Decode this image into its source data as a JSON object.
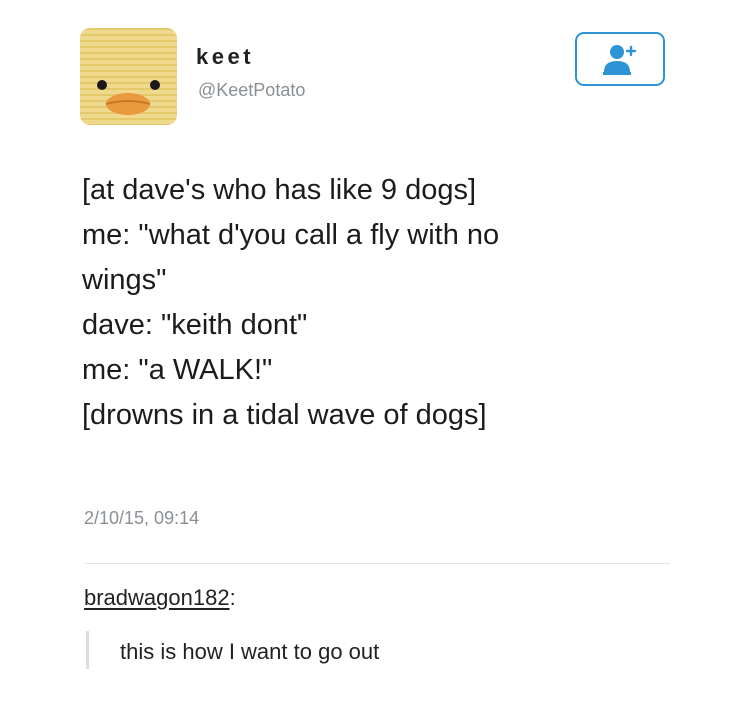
{
  "author": {
    "display_name": "keet",
    "handle": "@KeetPotato",
    "avatar_icon": "duck-face-avatar"
  },
  "follow_button": {
    "icon": "add-user-icon",
    "accent": "#2f94d6"
  },
  "tweet": {
    "lines": [
      "[at dave's who has like 9 dogs]",
      "me: \"what d'you call a fly with no",
      "wings\"",
      "dave: \"keith dont\"",
      "me: \"a WALK!\"",
      "[drowns in a tidal wave of dogs]"
    ],
    "timestamp": "2/10/15, 09:14"
  },
  "reblog": {
    "username": "bradwagon182",
    "separator": ":",
    "comment": "this is how I want to go out"
  }
}
